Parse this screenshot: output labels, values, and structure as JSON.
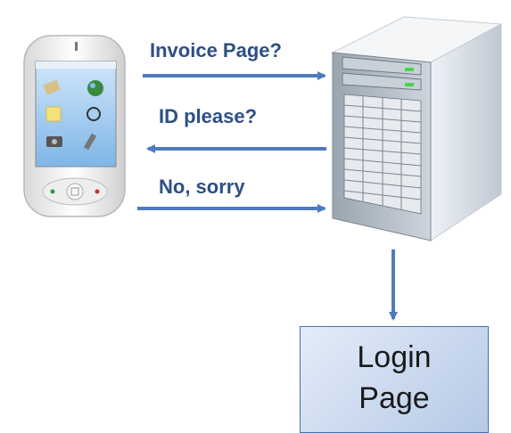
{
  "messages": [
    {
      "text": "Invoice Page?"
    },
    {
      "text": "ID please?"
    },
    {
      "text": "No, sorry"
    }
  ],
  "login_box": {
    "line1": "Login",
    "line2": "Page"
  },
  "icons": {
    "client": "smartphone-icon",
    "server": "server-tower-icon"
  },
  "colors": {
    "arrow": "#4f7abf",
    "label": "#2e4f86",
    "box_border": "#4a6fa5",
    "box_fill": "#c9d8ee"
  }
}
